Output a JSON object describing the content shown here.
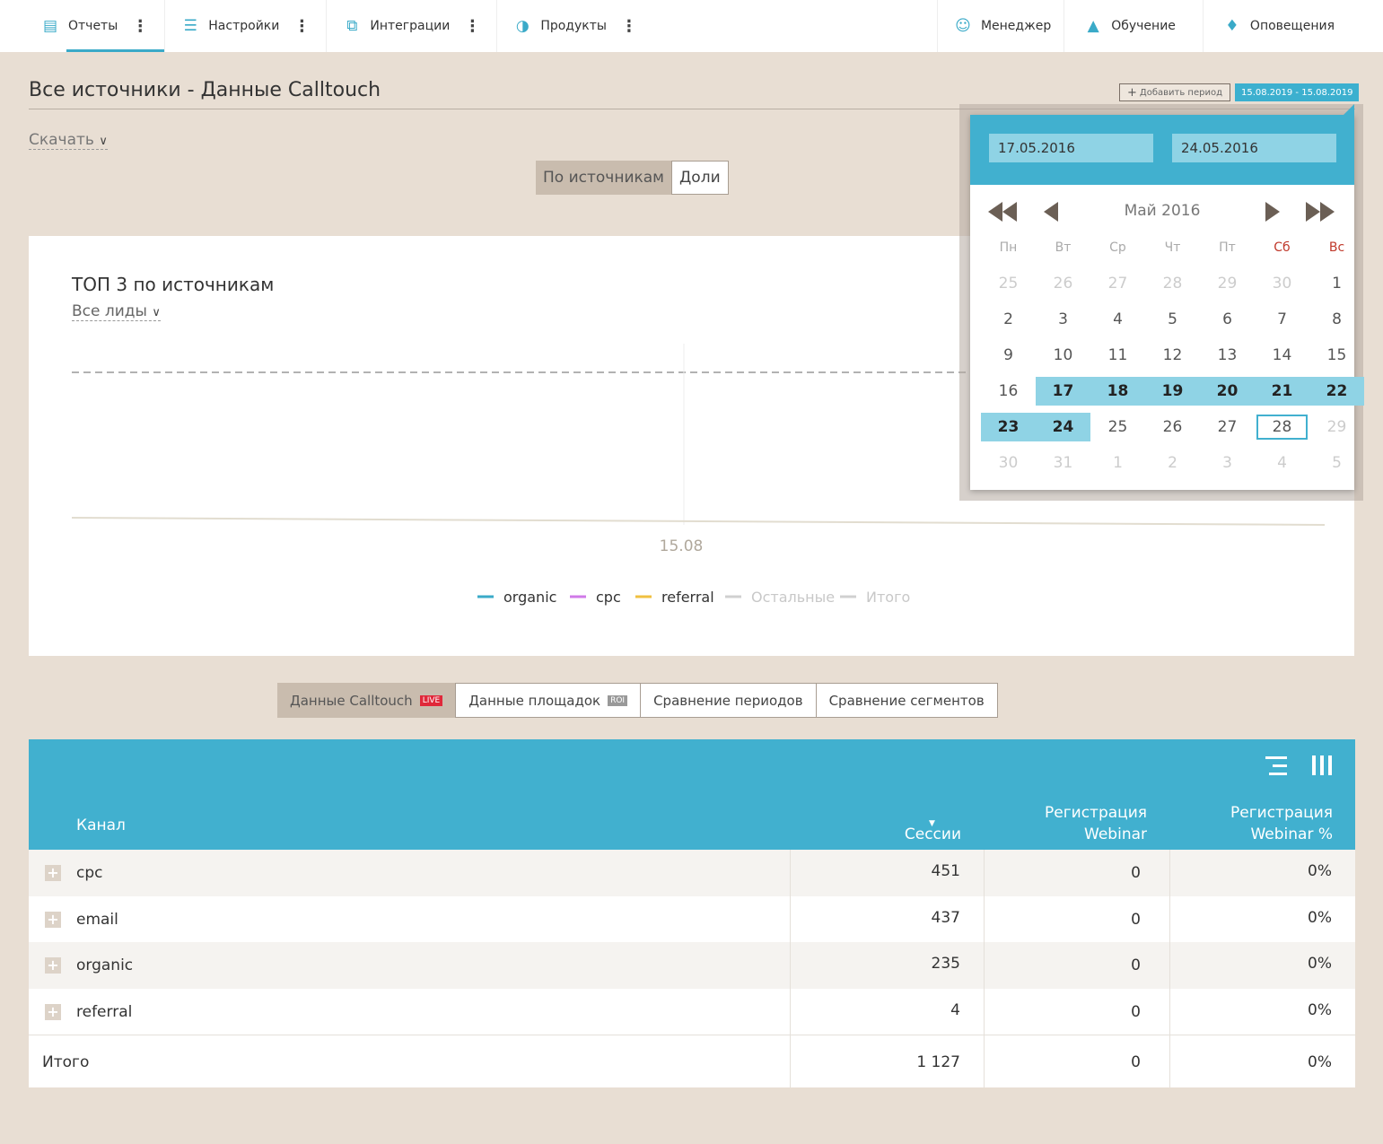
{
  "nav": {
    "left": [
      {
        "label": "Отчеты",
        "icon": "report-icon"
      },
      {
        "label": "Настройки",
        "icon": "sliders-icon"
      },
      {
        "label": "Интеграции",
        "icon": "integrations-icon"
      },
      {
        "label": "Продукты",
        "icon": "products-icon"
      }
    ],
    "right": [
      {
        "label": "Менеджер",
        "icon": "manager-icon"
      },
      {
        "label": "Обучение",
        "icon": "graduation-cap-icon"
      },
      {
        "label": "Оповещения",
        "icon": "bell-icon"
      }
    ]
  },
  "header": {
    "title": "Все источники - Данные Calltouch",
    "add_period": "Добавить период",
    "date_range": "15.08.2019 - 15.08.2019",
    "download": "Скачать"
  },
  "view_toggle": {
    "by_sources": "По источникам",
    "shares": "Доли"
  },
  "chart": {
    "title": "ТОП 3 по источникам",
    "metric_select": "Все лиды",
    "x_tick": "15.08",
    "legend": [
      {
        "name": "organic",
        "color": "#3aaac8",
        "active": true
      },
      {
        "name": "cpc",
        "color": "#d07ae8",
        "active": true
      },
      {
        "name": "referral",
        "color": "#f0c040",
        "active": true
      },
      {
        "name": "Остальные",
        "color": "#d0d0d0",
        "active": false
      },
      {
        "name": "Итого",
        "color": "#d0d0d0",
        "active": false
      }
    ]
  },
  "chart_data": {
    "type": "line",
    "title": "ТОП 3 по источникам",
    "x": [
      "15.08"
    ],
    "series": [
      {
        "name": "organic",
        "values": [
          0
        ]
      },
      {
        "name": "cpc",
        "values": [
          0
        ]
      },
      {
        "name": "referral",
        "values": [
          0
        ]
      }
    ],
    "legend_position": "bottom"
  },
  "report_tabs": [
    {
      "label": "Данные Calltouch",
      "badge": "LIVE"
    },
    {
      "label": "Данные площадок",
      "badge": "ROI"
    },
    {
      "label": "Сравнение периодов",
      "badge": ""
    },
    {
      "label": "Сравнение сегментов",
      "badge": ""
    }
  ],
  "table": {
    "col_channel": "Канал",
    "col_sessions": "Сессии",
    "col_reg_1": "Регистрация",
    "col_reg_2": "Webinar",
    "col_regp_1": "Регистрация",
    "col_regp_2": "Webinar %",
    "rows": [
      {
        "name": "cpc",
        "sessions": "451",
        "reg": "0",
        "regp": "0%"
      },
      {
        "name": "email",
        "sessions": "437",
        "reg": "0",
        "regp": "0%"
      },
      {
        "name": "organic",
        "sessions": "235",
        "reg": "0",
        "regp": "0%"
      },
      {
        "name": "referral",
        "sessions": "4",
        "reg": "0",
        "regp": "0%"
      }
    ],
    "total": {
      "name": "Итого",
      "sessions": "1 127",
      "reg": "0",
      "regp": "0%"
    }
  },
  "datepicker": {
    "from": "17.05.2016",
    "to": "24.05.2016",
    "month": "Май 2016",
    "weekdays": [
      "Пн",
      "Вт",
      "Ср",
      "Чт",
      "Пт",
      "Сб",
      "Вс"
    ],
    "weeks": [
      [
        "25",
        "26",
        "27",
        "28",
        "29",
        "30",
        "1"
      ],
      [
        "2",
        "3",
        "4",
        "5",
        "6",
        "7",
        "8"
      ],
      [
        "9",
        "10",
        "11",
        "12",
        "13",
        "14",
        "15"
      ],
      [
        "16",
        "17",
        "18",
        "19",
        "20",
        "21",
        "22"
      ],
      [
        "23",
        "24",
        "25",
        "26",
        "27",
        "28",
        "29"
      ],
      [
        "30",
        "31",
        "1",
        "2",
        "3",
        "4",
        "5"
      ]
    ]
  }
}
